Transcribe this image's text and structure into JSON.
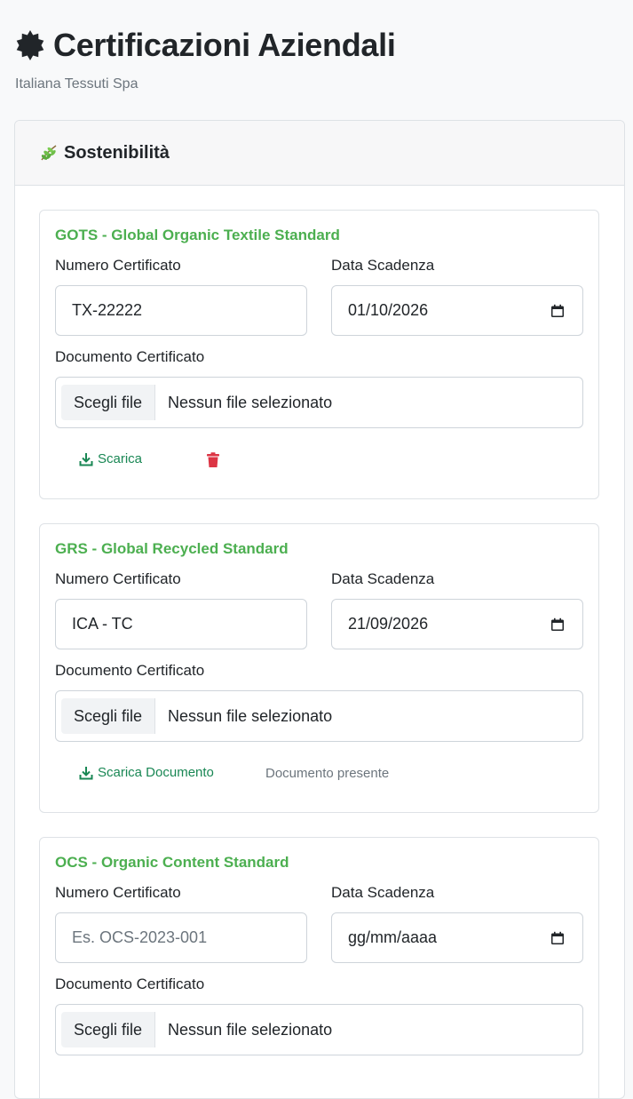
{
  "header": {
    "title": "Certificazioni Aziendali",
    "subtitle": "Italiana Tessuti Spa",
    "title_icon": "gear-badge-icon"
  },
  "section": {
    "title": "Sostenibilità",
    "icon": "leaf-icon"
  },
  "labels": {
    "cert_number": "Numero Certificato",
    "expiry_date": "Data Scadenza",
    "document": "Documento Certificato",
    "choose_file": "Scegli file",
    "no_file": "Nessun file selezionato"
  },
  "certifications": [
    {
      "name": "GOTS - Global Organic Textile Standard",
      "number": "TX-22222",
      "date": "01/10/2026",
      "download_label": "Scarica",
      "has_delete": true
    },
    {
      "name": "GRS - Global Recycled Standard",
      "number": "ICA - TC",
      "date": "21/09/2026",
      "download_label": "Scarica Documento",
      "status": "Documento presente"
    },
    {
      "name": "OCS - Organic Content Standard",
      "number_placeholder": "Es. OCS-2023-001",
      "date_placeholder": "gg/mm/aaaa"
    }
  ],
  "colors": {
    "accent_green": "#4caf50",
    "action_green": "#198754",
    "danger_red": "#dc3545"
  }
}
